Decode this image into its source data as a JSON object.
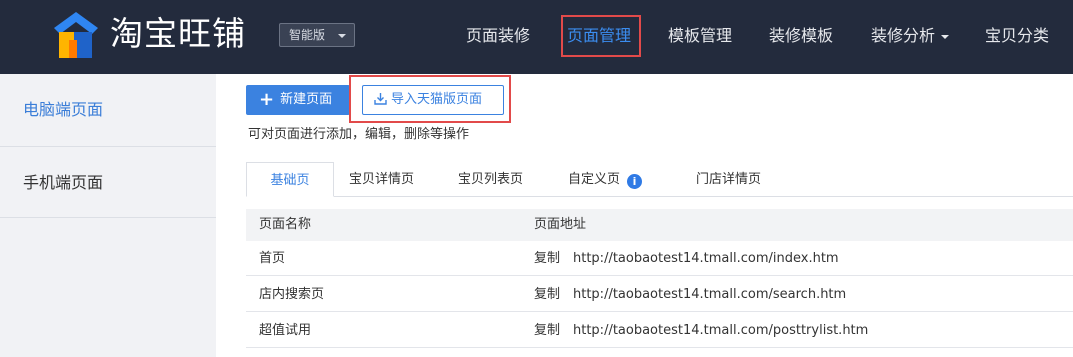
{
  "header": {
    "brand": "淘宝旺铺",
    "version_label": "智能版",
    "nav": [
      {
        "label": "页面装修",
        "active": false,
        "dropdown": false
      },
      {
        "label": "页面管理",
        "active": true,
        "dropdown": false
      },
      {
        "label": "模板管理",
        "active": false,
        "dropdown": false
      },
      {
        "label": "装修模板",
        "active": false,
        "dropdown": false
      },
      {
        "label": "装修分析",
        "active": false,
        "dropdown": true
      },
      {
        "label": "宝贝分类",
        "active": false,
        "dropdown": false
      }
    ]
  },
  "sidebar": {
    "items": [
      {
        "label": "电脑端页面",
        "active": true
      },
      {
        "label": "手机端页面",
        "active": false
      }
    ]
  },
  "toolbar": {
    "new_page_label": "新建页面",
    "import_label": "导入天猫版页面",
    "hint": "可对页面进行添加，编辑，删除等操作"
  },
  "tabs": [
    {
      "label": "基础页",
      "active": true
    },
    {
      "label": "宝贝详情页",
      "active": false
    },
    {
      "label": "宝贝列表页",
      "active": false
    },
    {
      "label": "自定义页",
      "active": false,
      "info": true
    },
    {
      "label": "门店详情页",
      "active": false
    }
  ],
  "table": {
    "columns": [
      "页面名称",
      "页面地址"
    ],
    "rows": [
      {
        "name": "首页",
        "copy": "复制",
        "url": "http://taobaotest14.tmall.com/index.htm"
      },
      {
        "name": "店内搜索页",
        "copy": "复制",
        "url": "http://taobaotest14.tmall.com/search.htm"
      },
      {
        "name": "超值试用",
        "copy": "复制",
        "url": "http://taobaotest14.tmall.com/posttrylist.htm"
      }
    ]
  },
  "colors": {
    "header_bg": "#232b3d",
    "accent": "#3b82e0",
    "highlight": "#e24a4a",
    "sidebar_bg": "#f1f2f5"
  }
}
